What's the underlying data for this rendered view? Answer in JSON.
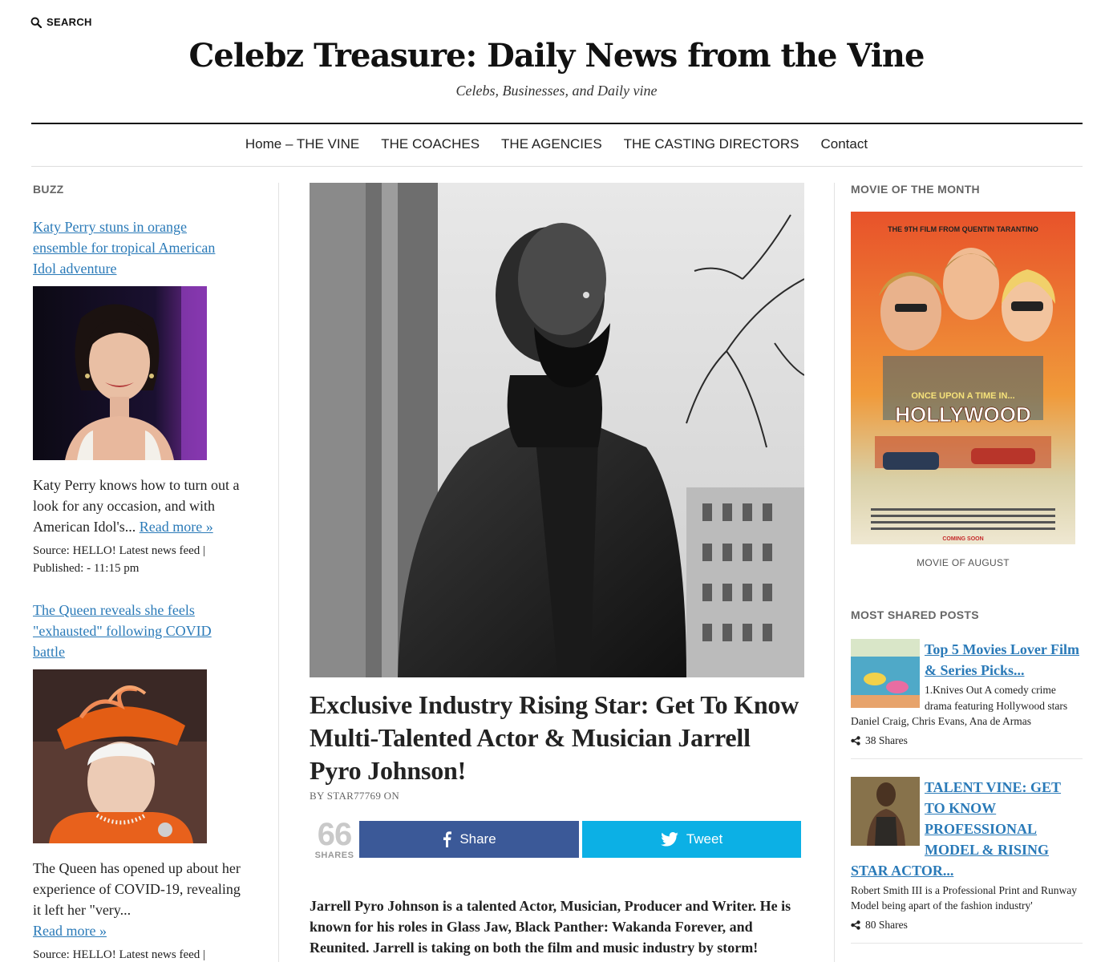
{
  "header": {
    "search_label": "SEARCH",
    "title": "Celebz Treasure: Daily News from the Vine",
    "tagline": "Celebs, Businesses, and Daily vine"
  },
  "nav": {
    "items": [
      "Home – THE VINE",
      "THE COACHES",
      "THE AGENCIES",
      "THE CASTING DIRECTORS",
      "Contact"
    ]
  },
  "buzz": {
    "title": "BUZZ",
    "items": [
      {
        "headline": "Katy Perry stuns in orange ensemble for tropical American Idol adventure",
        "excerpt": "Katy Perry knows how to turn out a look for any occasion, and with American Idol's...",
        "read_more": "Read more »",
        "source": "Source: HELLO! Latest news feed | Published: - 11:15 pm"
      },
      {
        "headline": "The Queen reveals she feels \"exhausted\" following COVID battle",
        "excerpt": "The Queen has opened up about her experience of COVID-19, revealing it left her \"very...",
        "read_more": "Read more »",
        "source": "Source: HELLO! Latest news feed |"
      }
    ]
  },
  "post": {
    "title": "Exclusive Industry Rising Star: Get To Know Multi-Talented Actor & Musician Jarrell Pyro Johnson!",
    "byline": "BY STAR77769 ON",
    "share_count": "66",
    "share_count_label": "SHARES",
    "facebook_label": "Share",
    "twitter_label": "Tweet",
    "excerpt": "Jarrell Pyro Johnson is a talented Actor, Musician, Producer and Writer. He is known for his roles in Glass Jaw, Black Panther: Wakanda Forever, and Reunited. Jarrell is taking on both the film and music industry by storm!"
  },
  "sidebar": {
    "movie_title": "MOVIE OF THE MONTH",
    "poster_top_text": "THE 9TH FILM FROM QUENTIN TARANTINO",
    "poster_title_1": "ONCE UPON A TIME IN...",
    "poster_title_2": "HOLLYWOOD",
    "poster_bottom": "COMING SOON",
    "movie_caption": "MOVIE OF AUGUST",
    "most_shared_title": "MOST SHARED POSTS",
    "shared": [
      {
        "headline": "Top 5 Movies Lover Film & Series Picks...",
        "desc": "1.Knives Out A comedy crime drama featuring Hollywood stars Daniel Craig, Chris Evans, Ana de Armas",
        "shares": "38 Shares"
      },
      {
        "headline": "TALENT VINE: GET TO KNOW PROFESSIONAL MODEL & RISING STAR ACTOR...",
        "desc": "Robert Smith III is a Professional Print and Runway Model being apart of the fashion industry'",
        "shares": "80 Shares"
      }
    ]
  }
}
